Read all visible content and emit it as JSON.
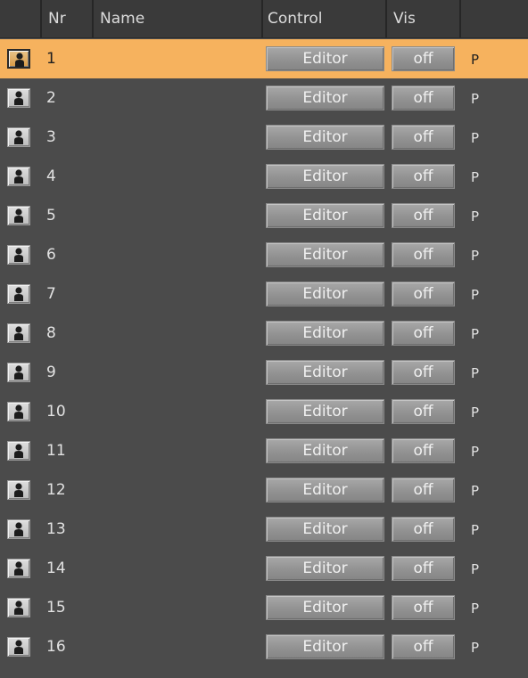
{
  "header": {
    "columns": [
      "",
      "Nr",
      "Name",
      "Control",
      "Vis",
      ""
    ]
  },
  "rows": [
    {
      "nr": "1",
      "control": "Editor",
      "vis": "off",
      "extra": "P",
      "selected": true
    },
    {
      "nr": "2",
      "control": "Editor",
      "vis": "off",
      "extra": "P",
      "selected": false
    },
    {
      "nr": "3",
      "control": "Editor",
      "vis": "off",
      "extra": "P",
      "selected": false
    },
    {
      "nr": "4",
      "control": "Editor",
      "vis": "off",
      "extra": "P",
      "selected": false
    },
    {
      "nr": "5",
      "control": "Editor",
      "vis": "off",
      "extra": "P",
      "selected": false
    },
    {
      "nr": "6",
      "control": "Editor",
      "vis": "off",
      "extra": "P",
      "selected": false
    },
    {
      "nr": "7",
      "control": "Editor",
      "vis": "off",
      "extra": "P",
      "selected": false
    },
    {
      "nr": "8",
      "control": "Editor",
      "vis": "off",
      "extra": "P",
      "selected": false
    },
    {
      "nr": "9",
      "control": "Editor",
      "vis": "off",
      "extra": "P",
      "selected": false
    },
    {
      "nr": "10",
      "control": "Editor",
      "vis": "off",
      "extra": "P",
      "selected": false
    },
    {
      "nr": "11",
      "control": "Editor",
      "vis": "off",
      "extra": "P",
      "selected": false
    },
    {
      "nr": "12",
      "control": "Editor",
      "vis": "off",
      "extra": "P",
      "selected": false
    },
    {
      "nr": "13",
      "control": "Editor",
      "vis": "off",
      "extra": "P",
      "selected": false
    },
    {
      "nr": "14",
      "control": "Editor",
      "vis": "off",
      "extra": "P",
      "selected": false
    },
    {
      "nr": "15",
      "control": "Editor",
      "vis": "off",
      "extra": "P",
      "selected": false
    },
    {
      "nr": "16",
      "control": "Editor",
      "vis": "off",
      "extra": "P",
      "selected": false
    }
  ],
  "icons": {
    "row_icon": "person-silhouette-icon"
  },
  "colors": {
    "background": "#4b4b4b",
    "header": "#3a3a3a",
    "selected_row": "#f6b25e",
    "button": "#969696"
  }
}
